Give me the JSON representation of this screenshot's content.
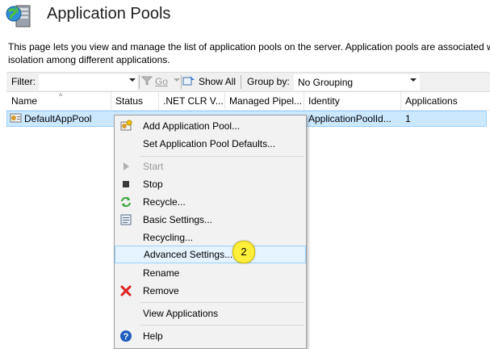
{
  "header": {
    "title": "Application Pools",
    "icon": "app-pools-server-globe-icon",
    "description_line1": "This page lets you view and manage the list of application pools on the server. Application pools are associated w",
    "description_line2": "isolation among different applications."
  },
  "filterbar": {
    "filter_label": "Filter:",
    "filter_value": "",
    "go_label": "Go",
    "show_all_label": "Show All",
    "group_by_label": "Group by:",
    "group_by_value": "No Grouping"
  },
  "grid": {
    "columns": [
      "Name",
      "Status",
      ".NET CLR V...",
      "Managed Pipel...",
      "Identity",
      "Applications"
    ],
    "rows": [
      {
        "name": "DefaultAppPool",
        "status": "",
        "clr": "",
        "pipeline": "",
        "identity": "ApplicationPoolId...",
        "applications": "1"
      }
    ]
  },
  "context_menu": {
    "items": [
      {
        "label": "Add Application Pool...",
        "icon": "add-app-pool-icon",
        "enabled": true
      },
      {
        "label": "Set Application Pool Defaults...",
        "icon": "",
        "enabled": true
      },
      {
        "label": "Start",
        "icon": "play-icon",
        "enabled": false
      },
      {
        "label": "Stop",
        "icon": "stop-icon",
        "enabled": true
      },
      {
        "label": "Recycle...",
        "icon": "recycle-icon",
        "enabled": true
      },
      {
        "label": "Basic Settings...",
        "icon": "settings-sheet-icon",
        "enabled": true
      },
      {
        "label": "Recycling...",
        "icon": "",
        "enabled": true
      },
      {
        "label": "Advanced Settings...",
        "icon": "",
        "enabled": true,
        "highlighted": true
      },
      {
        "label": "Rename",
        "icon": "",
        "enabled": true
      },
      {
        "label": "Remove",
        "icon": "remove-x-icon",
        "enabled": true
      },
      {
        "label": "View Applications",
        "icon": "",
        "enabled": true
      },
      {
        "label": "Help",
        "icon": "help-icon",
        "enabled": true
      }
    ],
    "step_badge": "2"
  },
  "colors": {
    "selection": "#cce8ff",
    "selection_border": "#99d1ff",
    "menu_bg": "#f2f2f2",
    "badge": "#ffef3a",
    "remove_red": "#e02020",
    "recycle_green": "#3aa63a",
    "help_blue": "#1f5fbf"
  }
}
